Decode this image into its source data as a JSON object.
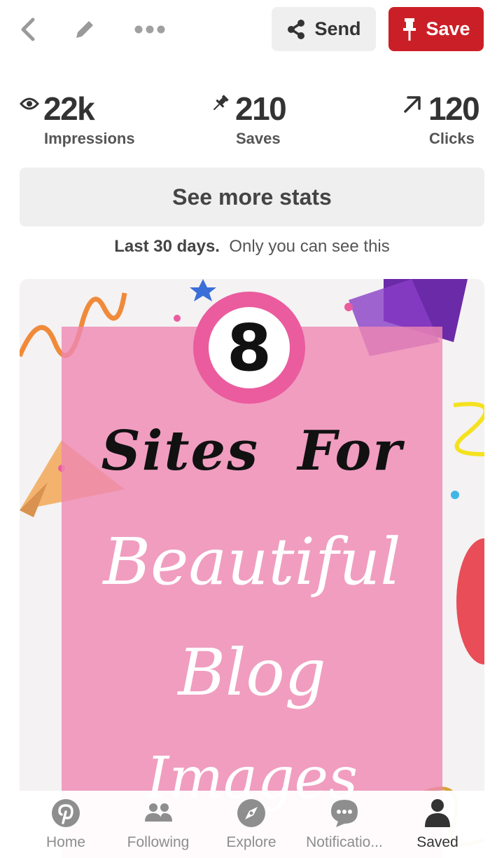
{
  "header": {
    "send_label": "Send",
    "save_label": "Save",
    "colors": {
      "save_bg": "#cb1f27",
      "send_bg": "#efefef"
    },
    "icons": [
      "back-icon",
      "edit-icon",
      "more-icon",
      "share-icon",
      "pin-icon"
    ]
  },
  "stats": {
    "impressions": {
      "value": "22k",
      "label": "Impressions",
      "icon": "eye-icon"
    },
    "saves": {
      "value": "210",
      "label": "Saves",
      "icon": "pushpin-icon"
    },
    "clicks": {
      "value": "120",
      "label": "Clicks",
      "icon": "arrow-up-right-icon"
    },
    "see_more_label": "See more stats",
    "range_bold": "Last 30 days.",
    "range_note": "Only you can see this"
  },
  "pin_image": {
    "badge_number": "8",
    "line1": "Sites For",
    "line2": "Beautiful",
    "line3": "Blog",
    "line4": "Images",
    "colors": {
      "overlay": "#ef87b3",
      "badge": "#ea5c9e"
    }
  },
  "bottom_nav": {
    "items": [
      {
        "label": "Home",
        "icon": "pinterest-logo-icon"
      },
      {
        "label": "Following",
        "icon": "people-icon"
      },
      {
        "label": "Explore",
        "icon": "compass-icon"
      },
      {
        "label": "Notificatio...",
        "icon": "chat-bubble-icon"
      },
      {
        "label": "Saved",
        "icon": "person-icon"
      }
    ],
    "active": "Saved"
  }
}
